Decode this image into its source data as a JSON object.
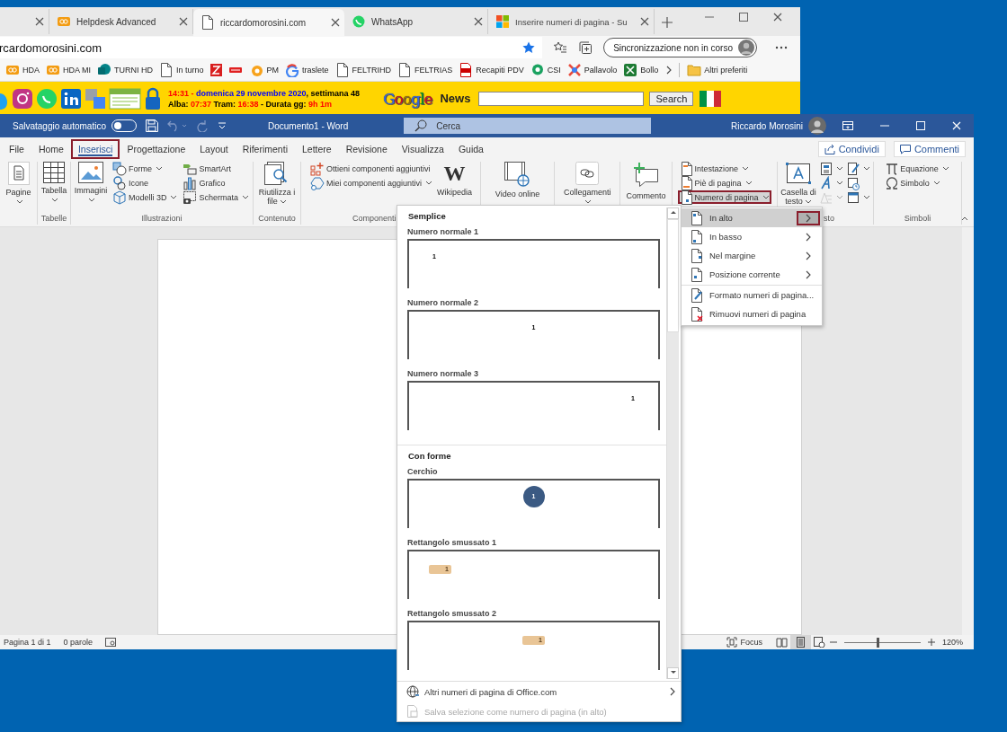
{
  "browser": {
    "tabs": [
      {
        "selected": false
      },
      {
        "title": "Helpdesk Advanced",
        "selected": false
      },
      {
        "title": "riccardomorosini.com",
        "selected": true
      },
      {
        "title": "WhatsApp",
        "selected": false
      },
      {
        "title": "Inserire numeri di pagina - Su",
        "selected": false
      }
    ],
    "address": "rcardomorosini.com",
    "sync_label": "Sincronizzazione non in corso",
    "bookmarks": [
      {
        "kind": "link",
        "label": "HDA"
      },
      {
        "kind": "link",
        "label": "HDA MI"
      },
      {
        "kind": "link",
        "label": "TURNI HD"
      },
      {
        "kind": "link",
        "label": "In turno"
      },
      {
        "kind": "icon"
      },
      {
        "kind": "icon"
      },
      {
        "kind": "link",
        "label": "PM"
      },
      {
        "kind": "link",
        "label": "traslete"
      },
      {
        "kind": "link",
        "label": "FELTRIHD"
      },
      {
        "kind": "link",
        "label": "FELTRIAS"
      },
      {
        "kind": "link",
        "label": "Recapiti PDV"
      },
      {
        "kind": "link",
        "label": "CSI"
      },
      {
        "kind": "link",
        "label": "Pallavolo"
      },
      {
        "kind": "link",
        "label": "Bollo"
      }
    ],
    "other_favorites": "Altri preferiti",
    "banner": {
      "date_line": [
        {
          "text": "14:31 - ",
          "color": "#ff0000"
        },
        {
          "text": "domenica 29 novembre 2020",
          "color": "#0000ff"
        },
        {
          "text": ", settimana 48",
          "color": "#000000"
        }
      ],
      "sun_line": [
        {
          "text": "Alba: ",
          "color": "#000000"
        },
        {
          "text": "07:37",
          "color": "#ff0000"
        },
        {
          "text": " Tram: ",
          "color": "#000000"
        },
        {
          "text": "16:38",
          "color": "#ff0000"
        },
        {
          "text": " - Durata gg: ",
          "color": "#000000"
        },
        {
          "text": "9h 1m",
          "color": "#ff0000"
        }
      ],
      "google": [
        {
          "text": "G",
          "color": "#3369e8"
        },
        {
          "text": "o",
          "color": "#d50f25"
        },
        {
          "text": "o",
          "color": "#a07000"
        },
        {
          "text": "g",
          "color": "#3369e8"
        },
        {
          "text": "l",
          "color": "#009925"
        },
        {
          "text": "e",
          "color": "#d50f25"
        }
      ],
      "news_label": "News",
      "search_button": "Search"
    }
  },
  "word": {
    "autosave_label": "Salvataggio automatico",
    "autosave_on": false,
    "document_title": "Documento1  -  Word",
    "search_placeholder": "Cerca",
    "user_name": "Riccardo Morosini",
    "tabs": [
      {
        "label": "File",
        "selected": false,
        "highlighted": false
      },
      {
        "label": "Home",
        "selected": false,
        "highlighted": false
      },
      {
        "label": "Inserisci",
        "selected": true,
        "highlighted": true
      },
      {
        "label": "Progettazione",
        "selected": false,
        "highlighted": false
      },
      {
        "label": "Layout",
        "selected": false,
        "highlighted": false
      },
      {
        "label": "Riferimenti",
        "selected": false,
        "highlighted": false
      },
      {
        "label": "Lettere",
        "selected": false,
        "highlighted": false
      },
      {
        "label": "Revisione",
        "selected": false,
        "highlighted": false
      },
      {
        "label": "Visualizza",
        "selected": false,
        "highlighted": false
      },
      {
        "label": "Guida",
        "selected": false,
        "highlighted": false
      }
    ],
    "share_button": "Condividi",
    "comments_button": "Commenti",
    "ribbon_groups": [
      {
        "columns": [
          [
            {
              "kind": "large",
              "label": "Pagine",
              "dropdown": true,
              "highlighted": false
            }
          ]
        ]
      },
      {
        "label": "Tabelle",
        "columns": [
          [
            {
              "kind": "large",
              "label": "Tabella",
              "dropdown": true,
              "highlighted": false
            }
          ]
        ]
      },
      {
        "label": "Illustrazioni",
        "columns": [
          [
            {
              "kind": "large",
              "label": "Immagini",
              "dropdown": true,
              "highlighted": false
            }
          ],
          [
            {
              "kind": "small",
              "label": "Forme",
              "dropdown": true,
              "highlighted": false
            },
            {
              "kind": "small",
              "label": "Icone",
              "dropdown": false,
              "highlighted": false
            },
            {
              "kind": "small",
              "label": "Modelli 3D",
              "dropdown": true,
              "highlighted": false
            }
          ],
          [
            {
              "kind": "small",
              "label": "SmartArt",
              "dropdown": false,
              "highlighted": false
            },
            {
              "kind": "small",
              "label": "Grafico",
              "dropdown": false,
              "highlighted": false
            },
            {
              "kind": "small",
              "label": "Schermata",
              "dropdown": true,
              "highlighted": false
            }
          ]
        ]
      },
      {
        "label": "Contenuto",
        "columns": [
          [
            {
              "kind": "large",
              "label": "Riutilizza i file",
              "dropdown": true,
              "highlighted": false
            }
          ]
        ]
      },
      {
        "label": "Componenti",
        "columns": [
          [
            {
              "kind": "small",
              "label": "Ottieni componenti aggiuntivi",
              "dropdown": false,
              "highlighted": false
            },
            {
              "kind": "small",
              "label": "Miei componenti aggiuntivi",
              "dropdown": true,
              "highlighted": false
            }
          ],
          [
            {
              "kind": "large",
              "label": "Wikipedia",
              "icon_text": "W",
              "dropdown": false,
              "highlighted": false
            }
          ]
        ]
      },
      {
        "columns": [
          [
            {
              "kind": "large",
              "label": "Video online",
              "dropdown": false,
              "highlighted": false
            }
          ]
        ]
      },
      {
        "columns": [
          [
            {
              "kind": "large",
              "label": "Collegamenti",
              "dropdown": true,
              "highlighted": false
            }
          ]
        ]
      },
      {
        "columns": [
          [
            {
              "kind": "large",
              "label": "Commento",
              "dropdown": false,
              "highlighted": false
            }
          ]
        ]
      },
      {
        "columns": [
          [
            {
              "kind": "small",
              "label": "Intestazione",
              "dropdown": true,
              "highlighted": false
            },
            {
              "kind": "small",
              "label": "Piè di pagina",
              "dropdown": true,
              "highlighted": false
            },
            {
              "kind": "small",
              "label": "Numero di pagina",
              "dropdown": true,
              "highlighted": true
            }
          ]
        ]
      },
      {
        "label": "sto",
        "columns": [
          [
            {
              "kind": "large",
              "label": "Casella di testo",
              "dropdown": true,
              "highlighted": false
            }
          ],
          [
            {
              "kind": "icon",
              "dropdown": true,
              "highlighted": false
            },
            {
              "kind": "icon",
              "dropdown": true,
              "highlighted": false
            },
            {
              "kind": "icon",
              "dropdown": true,
              "highlighted": false,
              "disabled": true
            }
          ],
          [
            {
              "kind": "icon",
              "dropdown": true,
              "highlighted": false
            },
            {
              "kind": "icon",
              "dropdown": false,
              "highlighted": false
            },
            {
              "kind": "icon",
              "dropdown": true,
              "highlighted": false
            }
          ]
        ]
      },
      {
        "label": "Simboli",
        "columns": [
          [
            {
              "kind": "small",
              "label": "Equazione",
              "dropdown": true,
              "highlighted": false
            },
            {
              "kind": "small",
              "label": "Simbolo",
              "dropdown": true,
              "highlighted": false
            }
          ]
        ]
      }
    ],
    "status": {
      "page": "Pagina 1 di 1",
      "words": "0 parole",
      "focus": "Focus",
      "zoom": "120%",
      "zoom_slider": {
        "level": 0.43
      },
      "views": [
        {
          "selected": false
        },
        {
          "selected": true
        },
        {
          "selected": false
        }
      ]
    }
  },
  "gallery": {
    "sections": [
      {
        "heading": "Semplice",
        "items": [
          {
            "label": "Numero normale 1",
            "kind": "plain_left",
            "number": "1"
          },
          {
            "label": "Numero normale 2",
            "kind": "plain_center",
            "number": "1"
          },
          {
            "label": "Numero normale 3",
            "kind": "plain_right",
            "number": "1"
          }
        ]
      },
      {
        "heading": "Con forme",
        "items": [
          {
            "label": "Cerchio",
            "kind": "circle_center",
            "number": "1"
          },
          {
            "label": "Rettangolo smussato 1",
            "kind": "rounded_left",
            "number": "1"
          },
          {
            "label": "Rettangolo smussato 2",
            "kind": "rounded_center",
            "number": "1"
          }
        ]
      }
    ],
    "footer": [
      {
        "label": "Altri numeri di pagina di Office.com",
        "disabled": false,
        "submenu": true
      },
      {
        "label": "Salva selezione come numero di pagina (in alto)",
        "disabled": true,
        "submenu": false
      }
    ]
  },
  "submenu": {
    "items": [
      {
        "label": "In alto",
        "selected": true,
        "submenu": true,
        "highlighted": true,
        "separator_before": false
      },
      {
        "label": "In basso",
        "selected": false,
        "submenu": true,
        "highlighted": false,
        "separator_before": false
      },
      {
        "label": "Nel margine",
        "selected": false,
        "submenu": true,
        "highlighted": false,
        "separator_before": false
      },
      {
        "label": "Posizione corrente",
        "selected": false,
        "submenu": true,
        "highlighted": false,
        "separator_before": false
      },
      {
        "label": "Formato numeri di pagina...",
        "selected": false,
        "submenu": false,
        "highlighted": false,
        "separator_before": true
      },
      {
        "label": "Rimuovi numeri di pagina",
        "selected": false,
        "submenu": false,
        "highlighted": false,
        "separator_before": false
      }
    ]
  }
}
